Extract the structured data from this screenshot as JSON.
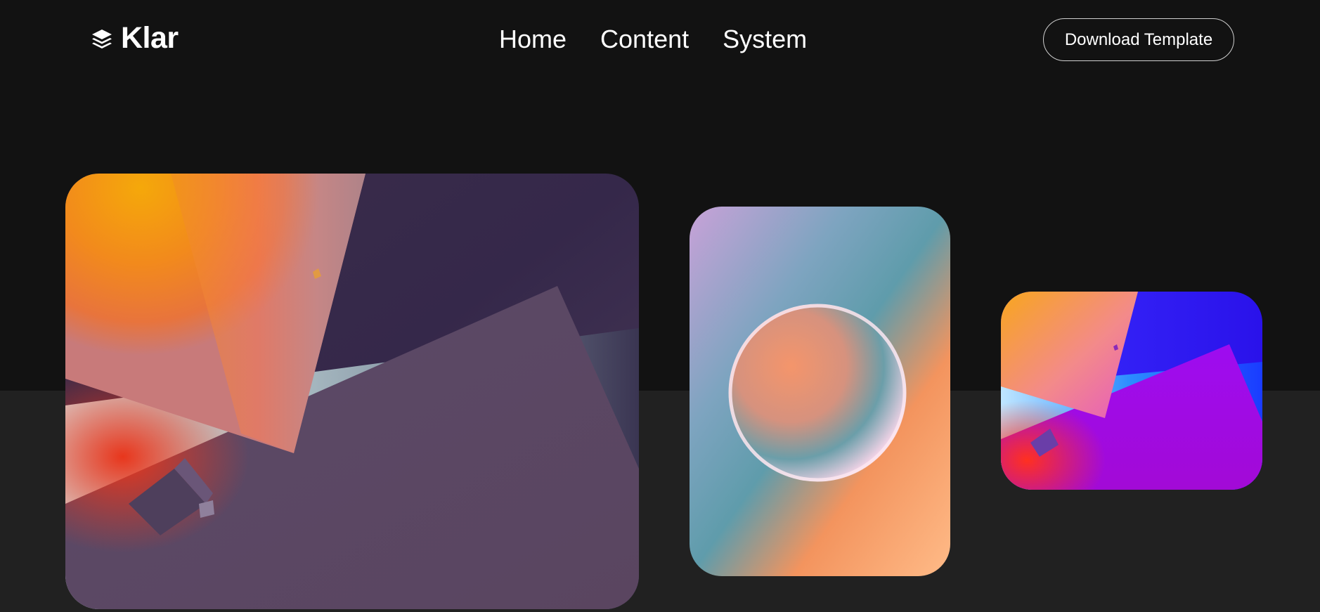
{
  "brand": {
    "name": "Klar",
    "icon": "layers-icon"
  },
  "nav": {
    "items": [
      {
        "label": "Home"
      },
      {
        "label": "Content"
      },
      {
        "label": "System"
      }
    ]
  },
  "header": {
    "download_label": "Download Template"
  },
  "gallery": {
    "cards": [
      {
        "name": "abstract-shapes-dusk-image"
      },
      {
        "name": "glass-sphere-gradient-image"
      },
      {
        "name": "abstract-shapes-vivid-image"
      }
    ]
  },
  "colors": {
    "background": "#121212",
    "band": "#212121",
    "text": "#ffffff",
    "accent_orange": "#f39a1a",
    "accent_purple": "#5e4a6a",
    "accent_violet": "#9a08e6"
  }
}
